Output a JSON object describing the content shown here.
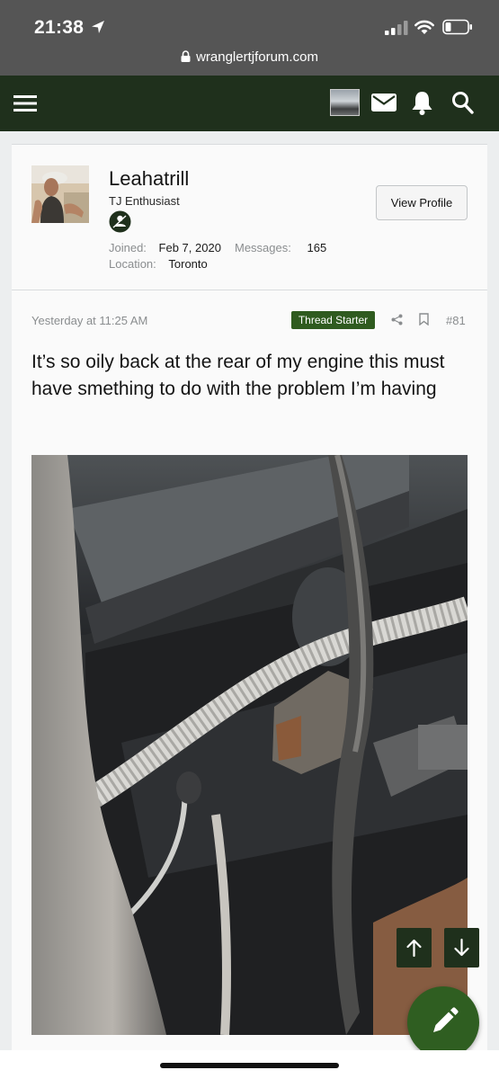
{
  "status_bar": {
    "time": "21:38",
    "url": "wranglertjforum.com"
  },
  "header": {
    "icons": [
      "menu-icon",
      "user-avatar",
      "mail-icon",
      "bell-icon",
      "search-icon"
    ],
    "background_color": "#1f301c"
  },
  "user": {
    "name": "Leahatrill",
    "title": "TJ Enthusiast",
    "view_profile_label": "View Profile",
    "joined_label": "Joined:",
    "joined_value": "Feb 7, 2020",
    "messages_label": "Messages:",
    "messages_value": "165",
    "location_label": "Location:",
    "location_value": "Toronto"
  },
  "post": {
    "date": "Yesterday at 11:25 AM",
    "badge": "Thread Starter",
    "number": "#81",
    "body": "It’s so oily back at the rear of my engine this must have smething to do with the problem I’m having"
  },
  "colors": {
    "accent_green": "#2f5b1f",
    "fab_green": "#2f5e21"
  }
}
